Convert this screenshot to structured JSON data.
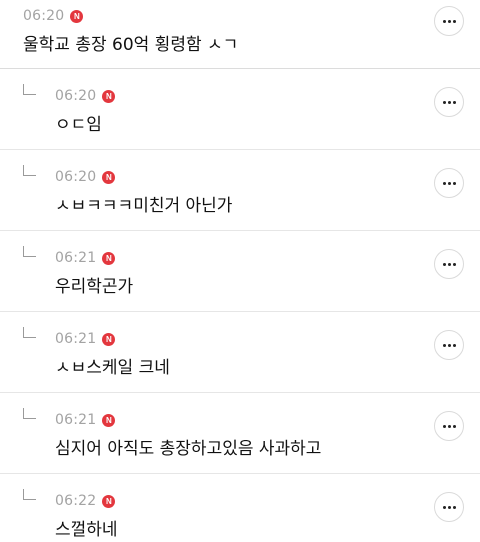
{
  "comments": [
    {
      "time": "06:20",
      "badge": "N",
      "text": "울학교 총장 60억 횡령함 ㅅㄱ",
      "is_reply": false
    },
    {
      "time": "06:20",
      "badge": "N",
      "text": "ㅇㄷ임",
      "is_reply": true
    },
    {
      "time": "06:20",
      "badge": "N",
      "text": "ㅅㅂㅋㅋㅋ미친거 아닌가",
      "is_reply": true
    },
    {
      "time": "06:21",
      "badge": "N",
      "text": "우리학곤가",
      "is_reply": true
    },
    {
      "time": "06:21",
      "badge": "N",
      "text": "ㅅㅂ스케일 크네",
      "is_reply": true
    },
    {
      "time": "06:21",
      "badge": "N",
      "text": "심지어 아직도 총장하고있음 사과하고",
      "is_reply": true
    },
    {
      "time": "06:22",
      "badge": "N",
      "text": "스껄하네",
      "is_reply": true
    }
  ],
  "icons": {
    "more": "more-dots-icon",
    "reply": "reply-arrow-icon",
    "new_badge": "new-badge-icon"
  },
  "colors": {
    "badge": "#e3373e",
    "time": "#a3a3a3",
    "text": "#111111",
    "divider": "#e6e6e6"
  }
}
